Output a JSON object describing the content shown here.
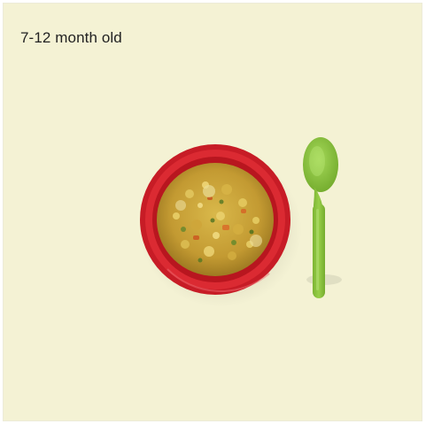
{
  "caption": "7-12 month old",
  "colors": {
    "background": "#f4f2d4",
    "bowl": "#d1202a",
    "spoon": "#8cc63f",
    "food": "#c9a53a"
  },
  "icons": {
    "bowl": "bowl-of-rice-icon",
    "spoon": "spoon-icon"
  }
}
